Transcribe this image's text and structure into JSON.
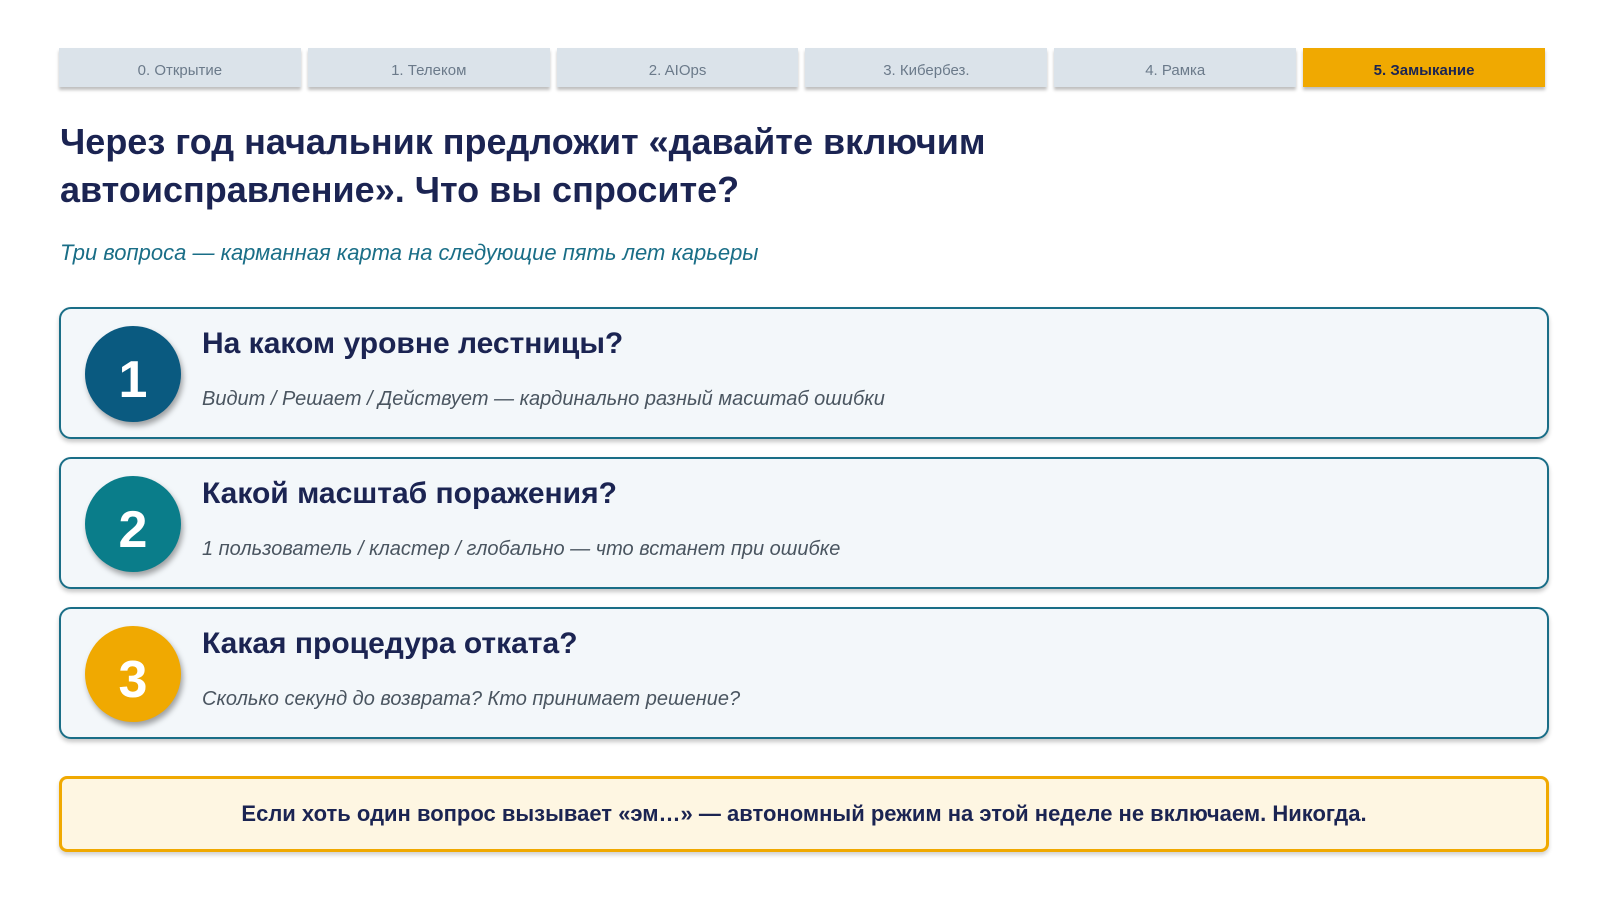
{
  "tabs": [
    {
      "label": "0. Открытие",
      "active": false
    },
    {
      "label": "1. Телеком",
      "active": false
    },
    {
      "label": "2. AIOps",
      "active": false
    },
    {
      "label": "3. Кибербез.",
      "active": false
    },
    {
      "label": "4. Рамка",
      "active": false
    },
    {
      "label": "5. Замыкание",
      "active": true
    }
  ],
  "header": {
    "title": "Через год начальник предложит «давайте включим автоисправление». Что вы спросите?",
    "subtitle": "Три вопроса — карманная карта на следующие пять лет карьеры"
  },
  "questions": [
    {
      "number": "1",
      "title": "На каком уровне лестницы?",
      "description": "Видит / Решает / Действует — кардинально разный масштаб ошибки",
      "color": "#0a5a80"
    },
    {
      "number": "2",
      "title": "Какой масштаб поражения?",
      "description": "1 пользователь / кластер / глобально — что встанет при ошибке",
      "color": "#0a7d8a"
    },
    {
      "number": "3",
      "title": "Какая процедура отката?",
      "description": "Сколько секунд до возврата? Кто принимает решение?",
      "color": "#f0a901"
    }
  ],
  "warning": {
    "text": "Если хоть один вопрос вызывает «эм…» — автономный режим на этой неделе не включаем. Никогда."
  },
  "colors": {
    "accent": "#f0a901",
    "primary_text": "#1b2452",
    "teal": "#1a6e87",
    "tab_inactive": "#dbe3ea"
  }
}
